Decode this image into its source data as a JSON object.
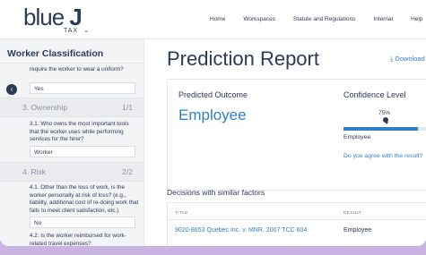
{
  "header": {
    "logo_text": "blue",
    "logo_letter": "J",
    "product": "TAX",
    "product_chevron": "⌄",
    "nav": [
      "Home",
      "Workspaces",
      "Statute and Regulations",
      "Internal",
      "Help"
    ]
  },
  "sidebar": {
    "title": "Worker Classification",
    "partial_question": "require the worker to wear a uniform?",
    "partial_answer": "Yes",
    "sections": [
      {
        "label": "3. Ownership",
        "count": "1/1"
      },
      {
        "label": "4. Risk",
        "count": "2/2"
      }
    ],
    "q31": "3.1. Who owns the most important tools that the worker uses while performing services for the hirer?",
    "a31": "Worker",
    "q41": "4.1. Other than the loss of work, is the worker personally at risk of loss? (e.g., liability, additional cost of re-doing work that fails to meet client satisfaction, etc.)",
    "a41": "No",
    "q42": "4.2. Is the worker reimbursed for work-related travel expenses?",
    "collapse_icon": "‹"
  },
  "main": {
    "title": "Prediction Report",
    "download_label": "⤓ Download",
    "predicted_outcome_label": "Predicted Outcome",
    "predicted_outcome_value": "Employee",
    "confidence_label": "Confidence Level",
    "confidence_pct": "75%",
    "confidence_value": 0.75,
    "confidence_outcome": "Employee",
    "agree_prompt": "Do you agree with the result?",
    "similar_title": "Decisions with similar factors",
    "table": {
      "headers": [
        "TITLE",
        "RESULT"
      ],
      "rows": [
        {
          "title": "9020-8653 Quebec Inc. v. MNR, 2007 TCC 604",
          "result": "Employee"
        }
      ]
    }
  },
  "colors": {
    "accent": "#2f7fc9",
    "navy": "#2c3a5a",
    "purple": "#b98bd9"
  }
}
